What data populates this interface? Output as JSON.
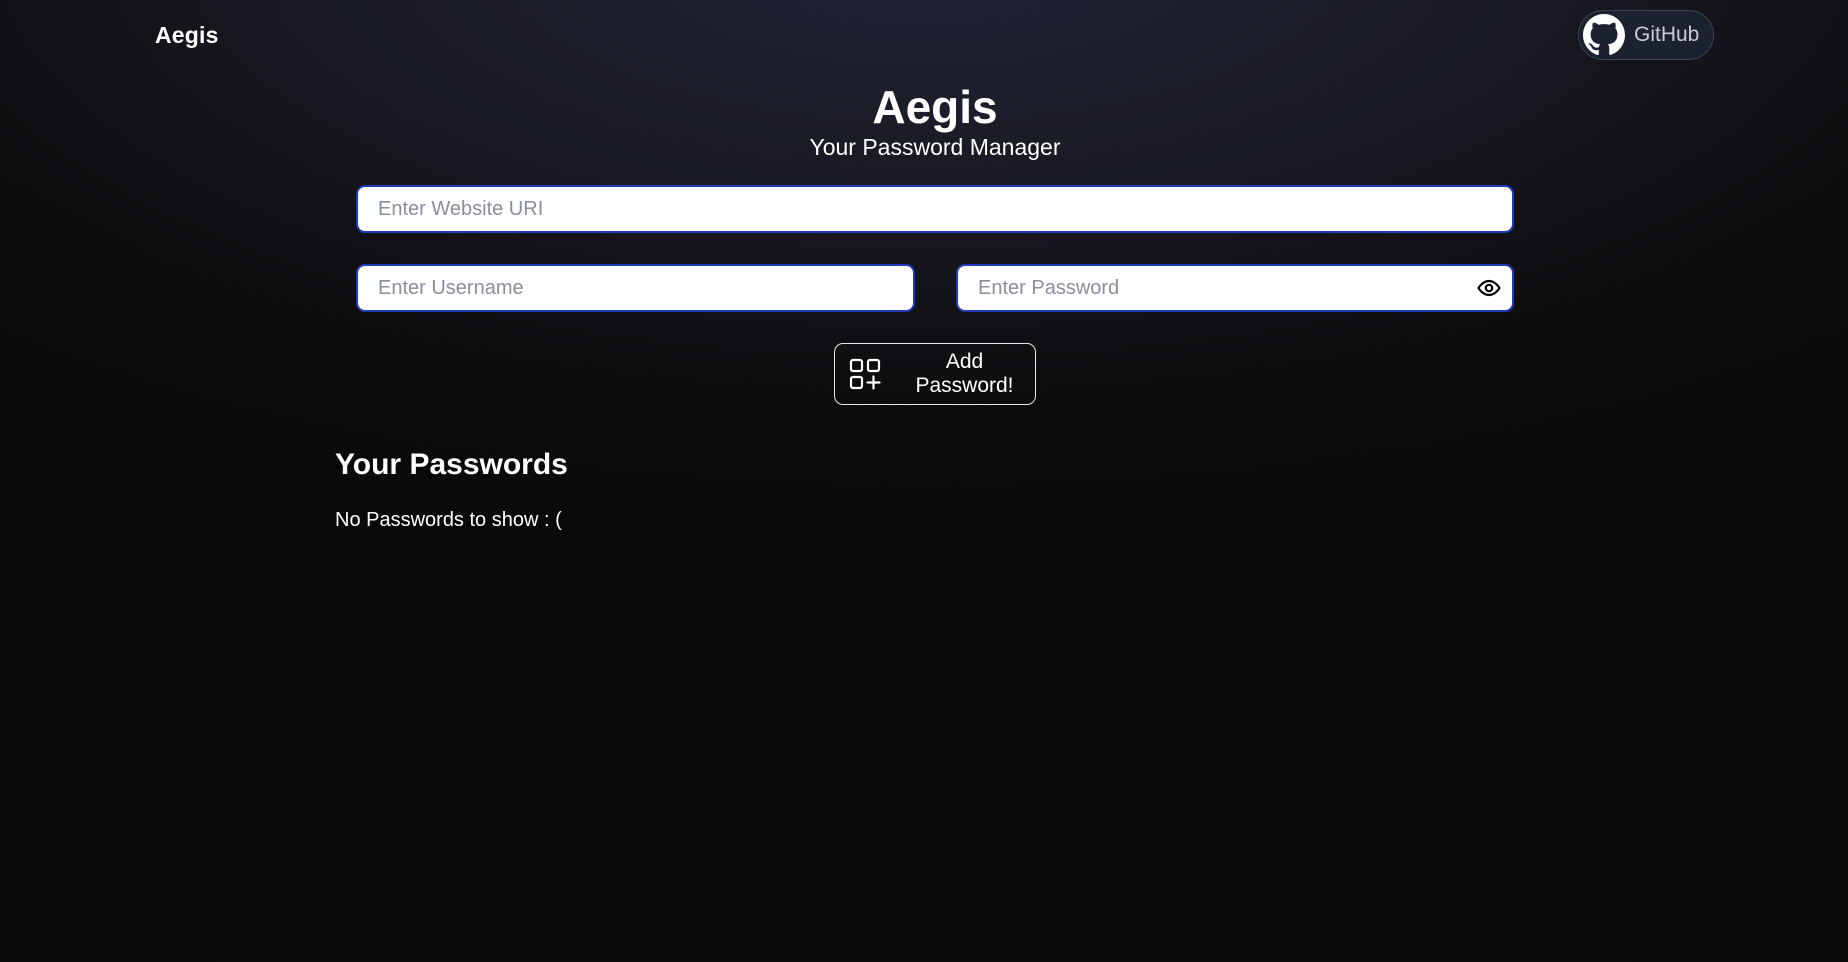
{
  "header": {
    "brand": "Aegis",
    "github_label": "GitHub",
    "github_icon": "github-icon"
  },
  "hero": {
    "title": "Aegis",
    "subtitle": "Your Password Manager"
  },
  "form": {
    "url_placeholder": "Enter Website URI",
    "url_value": "",
    "username_placeholder": "Enter Username",
    "username_value": "",
    "password_placeholder": "Enter Password",
    "password_value": "",
    "toggle_icon": "eye-icon",
    "add_label": "Add Password!",
    "add_icon": "add-grid-icon"
  },
  "passwords": {
    "title": "Your Passwords",
    "empty_message": "No Passwords to show : ("
  },
  "colors": {
    "input_border": "#1f3bb8",
    "background_top": "#23253a",
    "background_bottom": "#0a0a0a",
    "github_bg": "#1c2130"
  }
}
